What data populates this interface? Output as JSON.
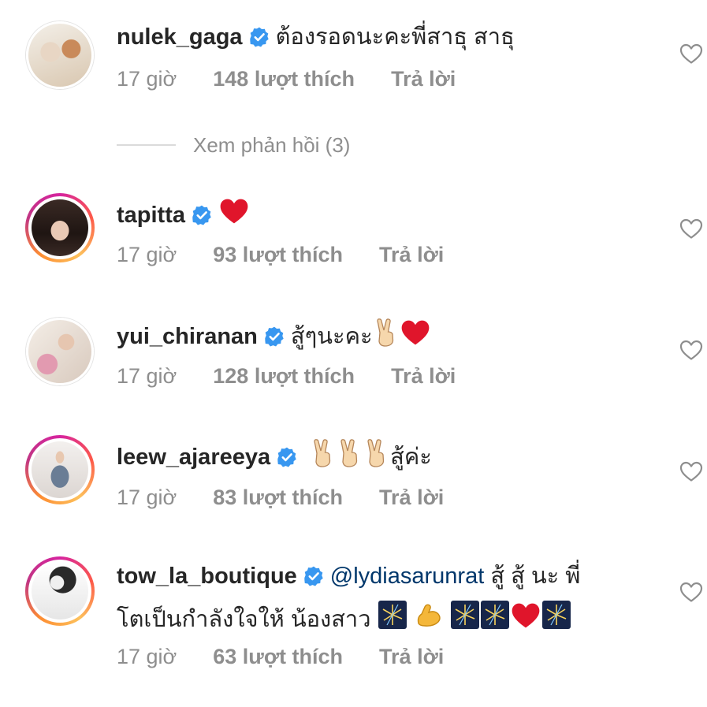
{
  "comments": [
    {
      "username": "nulek_gaga",
      "text_lines": [
        "ต้องรอดนะคะพี่สาธุ สาธุ"
      ],
      "time": "17 giờ",
      "likes": "148 lượt thích",
      "reply": "Trả lời",
      "story_ring": false
    },
    {
      "username": "tapitta",
      "text_lines": [
        ""
      ],
      "emojis": [
        "red-heart"
      ],
      "time": "17 giờ",
      "likes": "93 lượt thích",
      "reply": "Trả lời",
      "story_ring": true
    },
    {
      "username": "yui_chiranan",
      "text_lines": [
        "สู้ๆนะคะ"
      ],
      "emojis": [
        "victory-hand",
        "red-heart"
      ],
      "time": "17 giờ",
      "likes": "128 lượt thích",
      "reply": "Trả lời",
      "story_ring": false
    },
    {
      "username": "leew_ajareeya",
      "text_lines": [
        "สู้ค่ะ"
      ],
      "emojis": [
        "victory-hand",
        "victory-hand",
        "victory-hand"
      ],
      "time": "17 giờ",
      "likes": "83 lượt thích",
      "reply": "Trả lời",
      "story_ring": true
    },
    {
      "username": "tow_la_boutique",
      "mention": "@lydiasarunrat",
      "text_lines": [
        "สู้ สู้ นะ พี่",
        "โตเป็นกำลังใจให้ น้องสาว"
      ],
      "emojis": [
        "fireworks",
        "flexed-biceps",
        "fireworks",
        "fireworks",
        "red-heart",
        "fireworks"
      ],
      "time": "17 giờ",
      "likes": "63 lượt thích",
      "reply": "Trả lời",
      "story_ring": true
    }
  ],
  "view_replies": "Xem phản hồi (3)",
  "colors": {
    "text": "#262626",
    "muted": "#8e8e8e",
    "verified": "#3897f0",
    "mention": "#00376b",
    "heart": "#e0152b"
  }
}
